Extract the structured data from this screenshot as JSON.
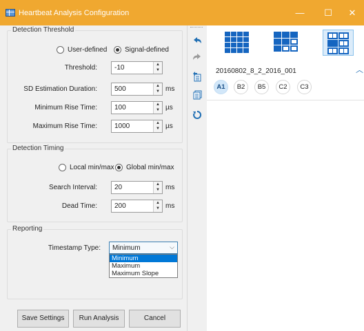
{
  "window": {
    "title": "Heartbeat Analysis Configuration",
    "minimize": "—",
    "maximize": "☐",
    "close": "✕"
  },
  "detection_threshold": {
    "group_label": "Detection Threshold",
    "radio_user": "User-defined",
    "radio_signal": "Signal-defined",
    "selected_mode": "Signal-defined",
    "threshold_label": "Threshold:",
    "threshold_value": "-10",
    "sd_label": "SD Estimation Duration:",
    "sd_value": "500",
    "sd_unit": "ms",
    "min_rise_label": "Minimum Rise Time:",
    "min_rise_value": "100",
    "min_rise_unit": "µs",
    "max_rise_label": "Maximum Rise Time:",
    "max_rise_value": "1000",
    "max_rise_unit": "µs"
  },
  "detection_timing": {
    "group_label": "Detection Timing",
    "radio_local": "Local min/max",
    "radio_global": "Global min/max",
    "selected_mode": "Global min/max",
    "search_label": "Search Interval:",
    "search_value": "20",
    "search_unit": "ms",
    "dead_label": "Dead Time:",
    "dead_value": "200",
    "dead_unit": "ms"
  },
  "reporting": {
    "group_label": "Reporting",
    "timestamp_label": "Timestamp Type:",
    "timestamp_value": "Minimum",
    "options": [
      "Minimum",
      "Maximum",
      "Maximum Slope"
    ],
    "highlighted_option": "Minimum"
  },
  "buttons": {
    "save": "Save Settings",
    "run": "Run Analysis",
    "cancel": "Cancel"
  },
  "toolstrip": {
    "icons": [
      "undo-icon",
      "redo-icon",
      "copy-to-channel-icon",
      "copy-to-all-icon",
      "reset-icon"
    ]
  },
  "right_panel": {
    "layouts": [
      "layout-4x4-icon",
      "layout-3x3-icon",
      "layout-2x3-icon"
    ],
    "active_layout": "layout-2x3-icon",
    "filename": "20160802_8_2_2016_001",
    "channels": [
      "A1",
      "B2",
      "B5",
      "C2",
      "C3"
    ],
    "active_channel": "A1"
  },
  "colors": {
    "titlebar": "#f0a830",
    "accent": "#1f6eb3",
    "selection": "#0078d7",
    "grid_icon": "#1565c0"
  }
}
